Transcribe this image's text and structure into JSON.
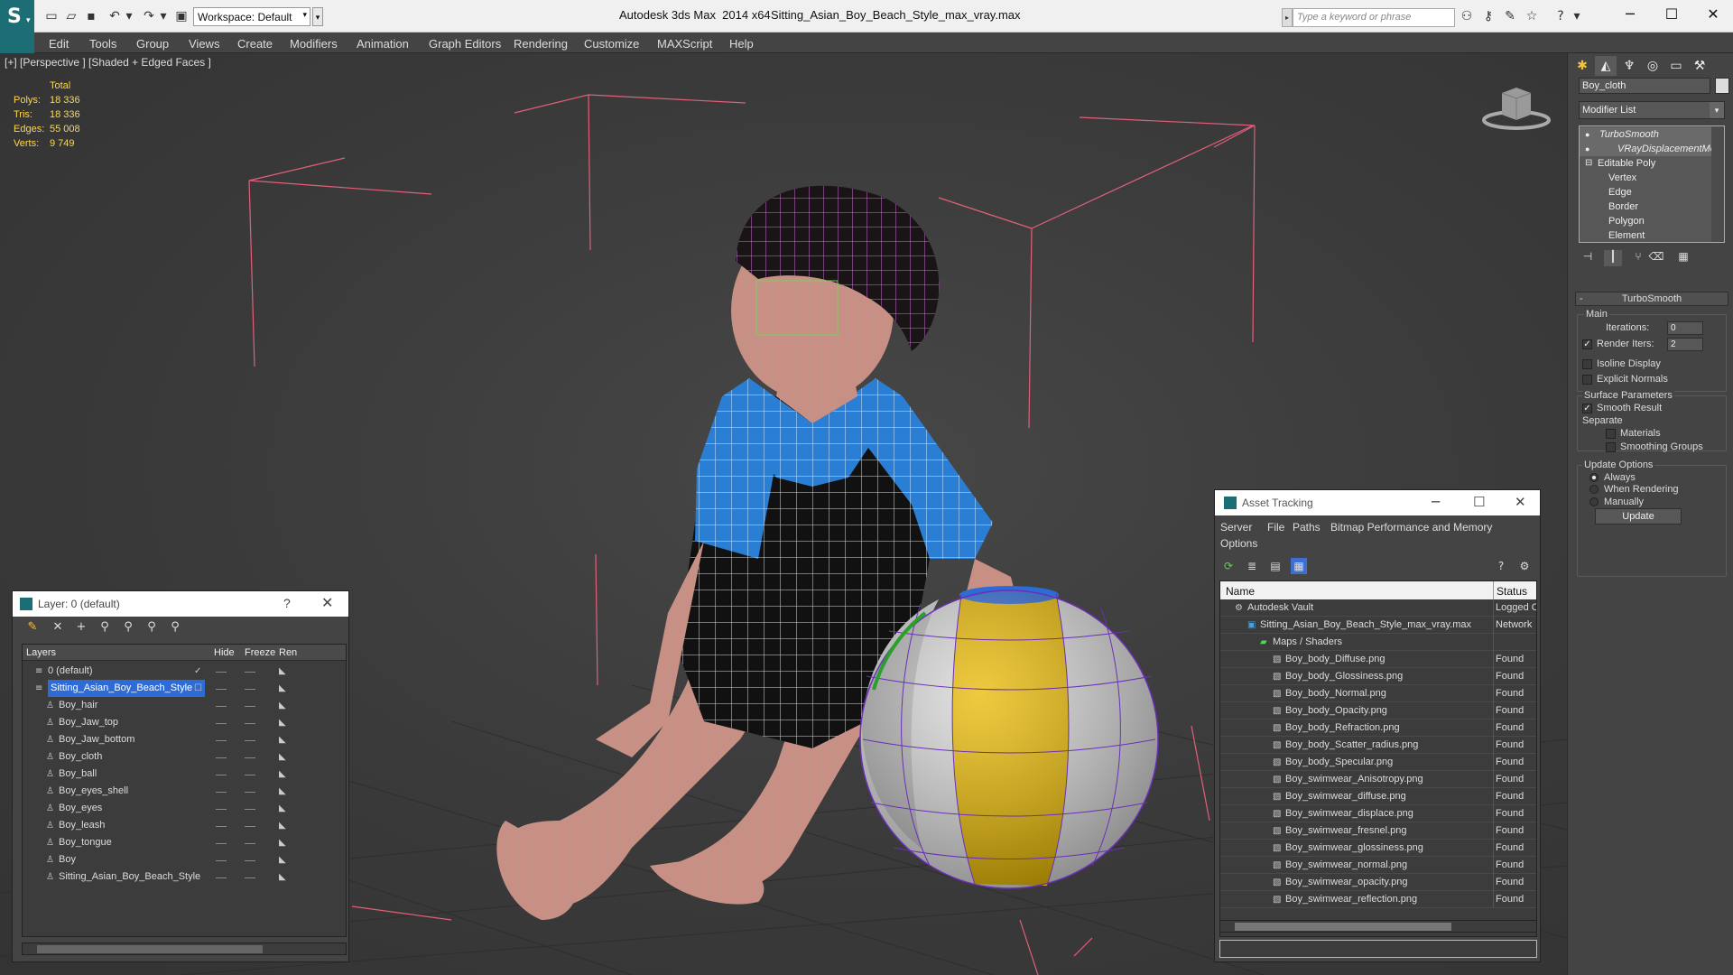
{
  "title_bar": {
    "app_title": "Autodesk 3ds Max  2014 x64",
    "file_title": "Sitting_Asian_Boy_Beach_Style_max_vray.max",
    "workspace_label": "Workspace: Default",
    "search_placeholder": "Type a keyword or phrase",
    "logo_letter": "S"
  },
  "menu": [
    "Edit",
    "Tools",
    "Group",
    "Views",
    "Create",
    "Modifiers",
    "Animation",
    "Graph Editors",
    "Rendering",
    "Customize",
    "MAXScript",
    "Help"
  ],
  "viewport": {
    "label": "[+] [Perspective ] [Shaded + Edged Faces ]",
    "stats": {
      "header": "Total",
      "rows": [
        {
          "label": "Polys:",
          "value": "18 336"
        },
        {
          "label": "Tris:",
          "value": "18 336"
        },
        {
          "label": "Edges:",
          "value": "55 008"
        },
        {
          "label": "Verts:",
          "value": "9 749"
        }
      ]
    }
  },
  "command_panel": {
    "object_name": "Boy_cloth",
    "modifier_list": "Modifier List",
    "stack": [
      "TurboSmooth",
      "VRayDisplacementMod",
      "Editable Poly",
      "Vertex",
      "Edge",
      "Border",
      "Polygon",
      "Element"
    ],
    "rollout_title": "TurboSmooth",
    "main_label": "Main",
    "iterations_label": "Iterations:",
    "iterations_value": "0",
    "render_iters_label": "Render Iters:",
    "render_iters_value": "2",
    "render_iters_checked": true,
    "isoline_label": "Isoline Display",
    "explicit_normals_label": "Explicit Normals",
    "surface_params_label": "Surface Parameters",
    "smooth_result_label": "Smooth Result",
    "smooth_result_checked": true,
    "separate_label": "Separate",
    "materials_label": "Materials",
    "smoothing_groups_label": "Smoothing Groups",
    "update_options_label": "Update Options",
    "update_always": "Always",
    "update_when_rendering": "When Rendering",
    "update_manually": "Manually",
    "update_button": "Update"
  },
  "layer_window": {
    "title": "Layer: 0 (default)",
    "help": "?",
    "columns": {
      "layers": "Layers",
      "hide": "Hide",
      "freeze": "Freeze",
      "render": "Ren"
    },
    "rows": [
      {
        "name": "0 (default)",
        "level": 0,
        "type": "layer",
        "checked": true
      },
      {
        "name": "Sitting_Asian_Boy_Beach_Style",
        "level": 0,
        "type": "layer",
        "selected": true
      },
      {
        "name": "Boy_hair",
        "level": 1,
        "type": "object"
      },
      {
        "name": "Boy_Jaw_top",
        "level": 1,
        "type": "object"
      },
      {
        "name": "Boy_Jaw_bottom",
        "level": 1,
        "type": "object"
      },
      {
        "name": "Boy_cloth",
        "level": 1,
        "type": "object"
      },
      {
        "name": "Boy_ball",
        "level": 1,
        "type": "object"
      },
      {
        "name": "Boy_eyes_shell",
        "level": 1,
        "type": "object"
      },
      {
        "name": "Boy_eyes",
        "level": 1,
        "type": "object"
      },
      {
        "name": "Boy_leash",
        "level": 1,
        "type": "object"
      },
      {
        "name": "Boy_tongue",
        "level": 1,
        "type": "object"
      },
      {
        "name": "Boy",
        "level": 1,
        "type": "object"
      },
      {
        "name": "Sitting_Asian_Boy_Beach_Style",
        "level": 1,
        "type": "object"
      }
    ]
  },
  "asset_tracking": {
    "title": "Asset Tracking",
    "menu": [
      "Server",
      "File",
      "Paths",
      "Bitmap Performance and Memory",
      "Options"
    ],
    "columns": {
      "name": "Name",
      "status": "Status"
    },
    "rows": [
      {
        "name": "Autodesk Vault",
        "status": "Logged Out",
        "level": 0,
        "icon": "vault"
      },
      {
        "name": "Sitting_Asian_Boy_Beach_Style_max_vray.max",
        "status": "Network",
        "level": 1,
        "icon": "max"
      },
      {
        "name": "Maps / Shaders",
        "status": "",
        "level": 2,
        "icon": "folder"
      },
      {
        "name": "Boy_body_Diffuse.png",
        "status": "Found",
        "level": 3,
        "icon": "file"
      },
      {
        "name": "Boy_body_Glossiness.png",
        "status": "Found",
        "level": 3,
        "icon": "file"
      },
      {
        "name": "Boy_body_Normal.png",
        "status": "Found",
        "level": 3,
        "icon": "file"
      },
      {
        "name": "Boy_body_Opacity.png",
        "status": "Found",
        "level": 3,
        "icon": "file"
      },
      {
        "name": "Boy_body_Refraction.png",
        "status": "Found",
        "level": 3,
        "icon": "file"
      },
      {
        "name": "Boy_body_Scatter_radius.png",
        "status": "Found",
        "level": 3,
        "icon": "file"
      },
      {
        "name": "Boy_body_Specular.png",
        "status": "Found",
        "level": 3,
        "icon": "file"
      },
      {
        "name": "Boy_swimwear_Anisotropy.png",
        "status": "Found",
        "level": 3,
        "icon": "file"
      },
      {
        "name": "Boy_swimwear_diffuse.png",
        "status": "Found",
        "level": 3,
        "icon": "file"
      },
      {
        "name": "Boy_swimwear_displace.png",
        "status": "Found",
        "level": 3,
        "icon": "file"
      },
      {
        "name": "Boy_swimwear_fresnel.png",
        "status": "Found",
        "level": 3,
        "icon": "file"
      },
      {
        "name": "Boy_swimwear_glossiness.png",
        "status": "Found",
        "level": 3,
        "icon": "file"
      },
      {
        "name": "Boy_swimwear_normal.png",
        "status": "Found",
        "level": 3,
        "icon": "file"
      },
      {
        "name": "Boy_swimwear_opacity.png",
        "status": "Found",
        "level": 3,
        "icon": "file"
      },
      {
        "name": "Boy_swimwear_reflection.png",
        "status": "Found",
        "level": 3,
        "icon": "file"
      }
    ]
  },
  "colors": {
    "accent_teal": "#1d6e74",
    "selection_blue": "#2f6bd6",
    "stats_yellow": "#ffd84a",
    "wire_pink": "#e0607a",
    "shirt_blue": "#2a7fd4",
    "ball_yellow": "#e8b800"
  }
}
